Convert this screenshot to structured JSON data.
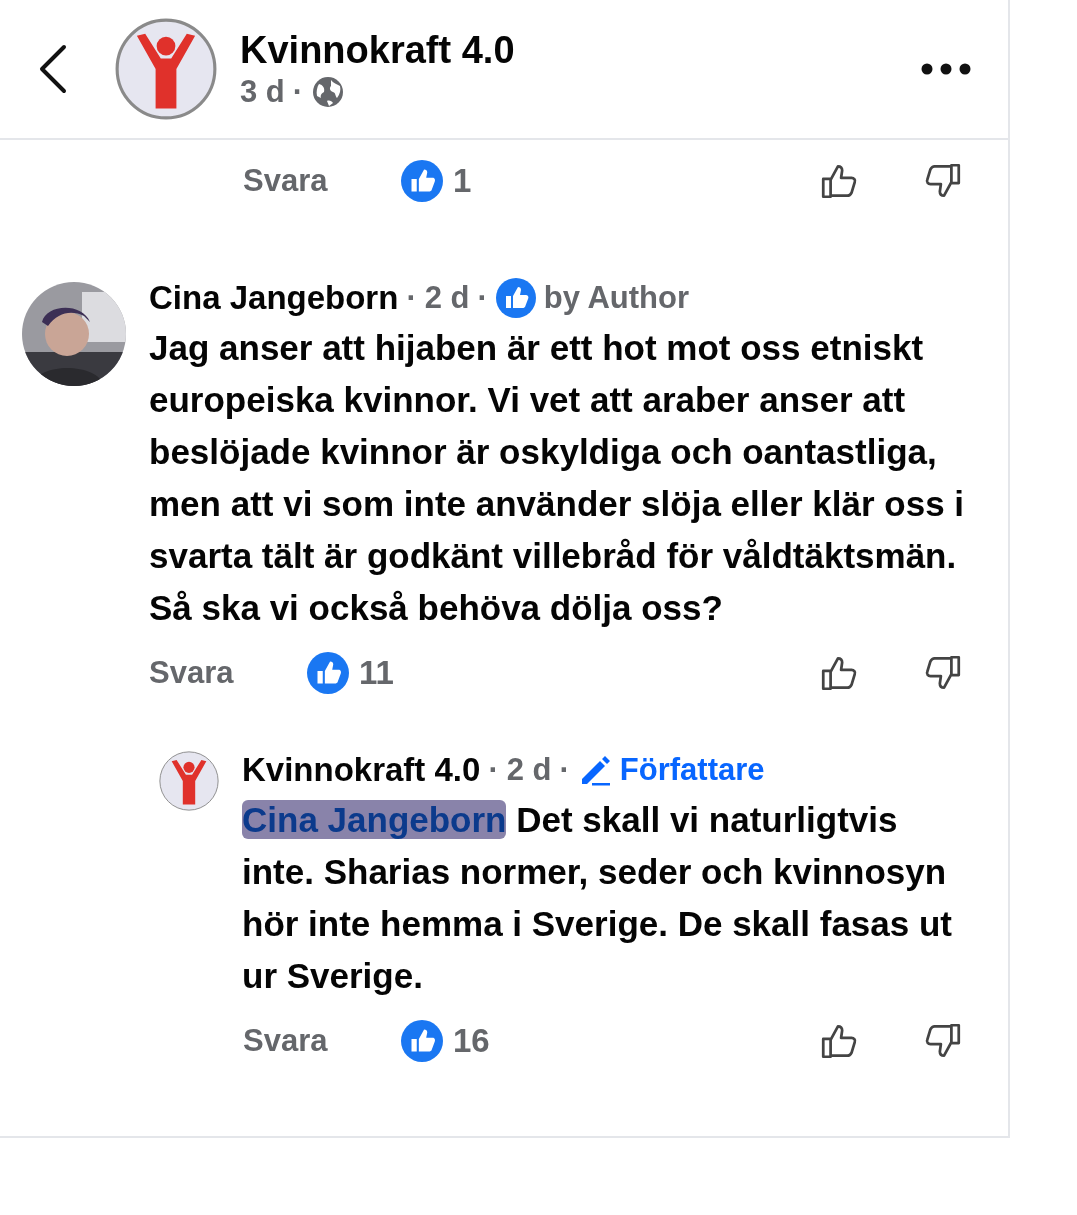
{
  "header": {
    "page_name": "Kvinnokraft 4.0",
    "time": "3 d",
    "separator": "·"
  },
  "top_actions": {
    "reply_label": "Svara",
    "like_count": "1"
  },
  "comments": [
    {
      "kind": "user",
      "author": "Cina Jangeborn",
      "separator": "·",
      "time": "2 d",
      "badge": {
        "kind": "liked",
        "label": "by Author"
      },
      "text": "Jag anser att hijaben är ett hot mot oss etniskt europeiska kvinnor. Vi vet att araber anser att beslöjade kvinnor är oskyldiga och oantastliga, men att vi som inte använder slöja eller klär oss i svarta tält är godkänt villebråd för våldtäktsmän. Så ska vi också behöva dölja oss?",
      "reply_label": "Svara",
      "like_count": "11",
      "children": [
        {
          "kind": "page",
          "author": "Kvinnokraft 4.0",
          "separator": "·",
          "time": "2 d",
          "badge": {
            "kind": "author",
            "label": "Författare"
          },
          "mention": "Cina Jangeborn",
          "text": "Det skall vi naturligtvis inte. Sharias normer, seder och kvinnosyn hör inte hemma i Sverige. De skall fasas ut ur Sverige.",
          "reply_label": "Svara",
          "like_count": "16"
        }
      ]
    }
  ]
}
